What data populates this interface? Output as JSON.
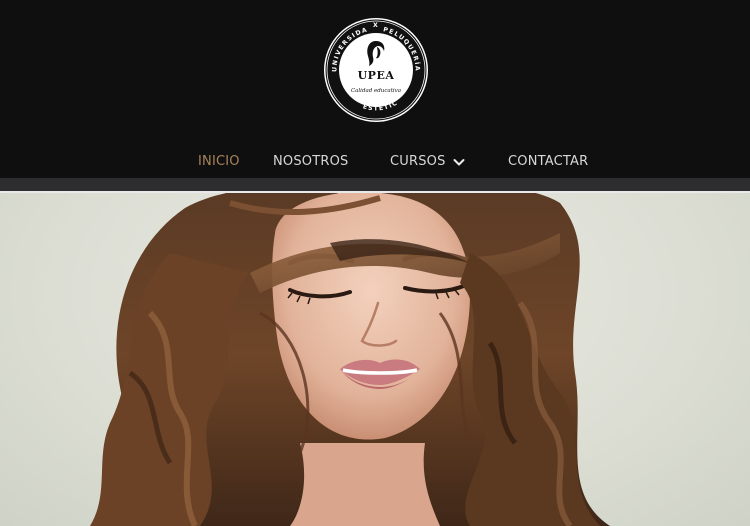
{
  "logo": {
    "brand": "UPEA",
    "slogan": "Calidad educativa",
    "ring_left": "UNIVERSIDAD",
    "ring_right": "PELUQUERÍA",
    "ring_bottom": "ESTÉTICA",
    "separator": "X"
  },
  "nav": {
    "items": [
      {
        "label": "INICIO",
        "active": true
      },
      {
        "label": "NOSOTROS"
      },
      {
        "label": "CURSOS",
        "has_dropdown": true
      },
      {
        "label": "CONTACTAR"
      }
    ]
  },
  "colors": {
    "header_bg": "#0f0f0f",
    "nav_text": "#d8d8d8",
    "nav_active": "#a8845a",
    "divider": "#2d2d2f"
  },
  "icons": {
    "cursos_dropdown": "chevron-down-icon",
    "logo_emblem": "woman-silhouette-icon"
  }
}
